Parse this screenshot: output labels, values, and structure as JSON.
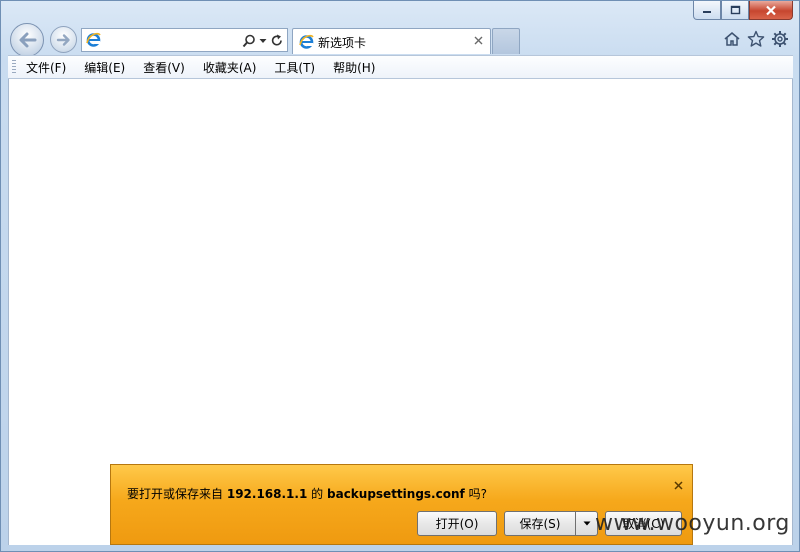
{
  "window": {
    "caption_buttons": [
      "minimize-icon",
      "maximize-icon",
      "close-icon"
    ]
  },
  "address": {
    "value": "",
    "icon": "ie-logo-icon",
    "tools": [
      "search-icon",
      "dropdown-icon",
      "refresh-icon"
    ]
  },
  "tabs": [
    {
      "title": "新选项卡",
      "icon": "ie-logo-icon"
    }
  ],
  "toolbar_icons": [
    "home-icon",
    "favorites-star-icon",
    "settings-gear-icon"
  ],
  "menu": {
    "items": [
      "文件(F)",
      "编辑(E)",
      "查看(V)",
      "收藏夹(A)",
      "工具(T)",
      "帮助(H)"
    ]
  },
  "download_bar": {
    "msg_prefix": "要打开或保存来自",
    "host": "192.168.1.1",
    "msg_mid": "的",
    "filename": "backupsettings.conf",
    "msg_suffix": "吗?",
    "open_label": "打开(O)",
    "save_label": "保存(S)",
    "cancel_label": "取消(C)",
    "accent": "#f6a81b"
  },
  "watermark": "www.wooyun.org"
}
